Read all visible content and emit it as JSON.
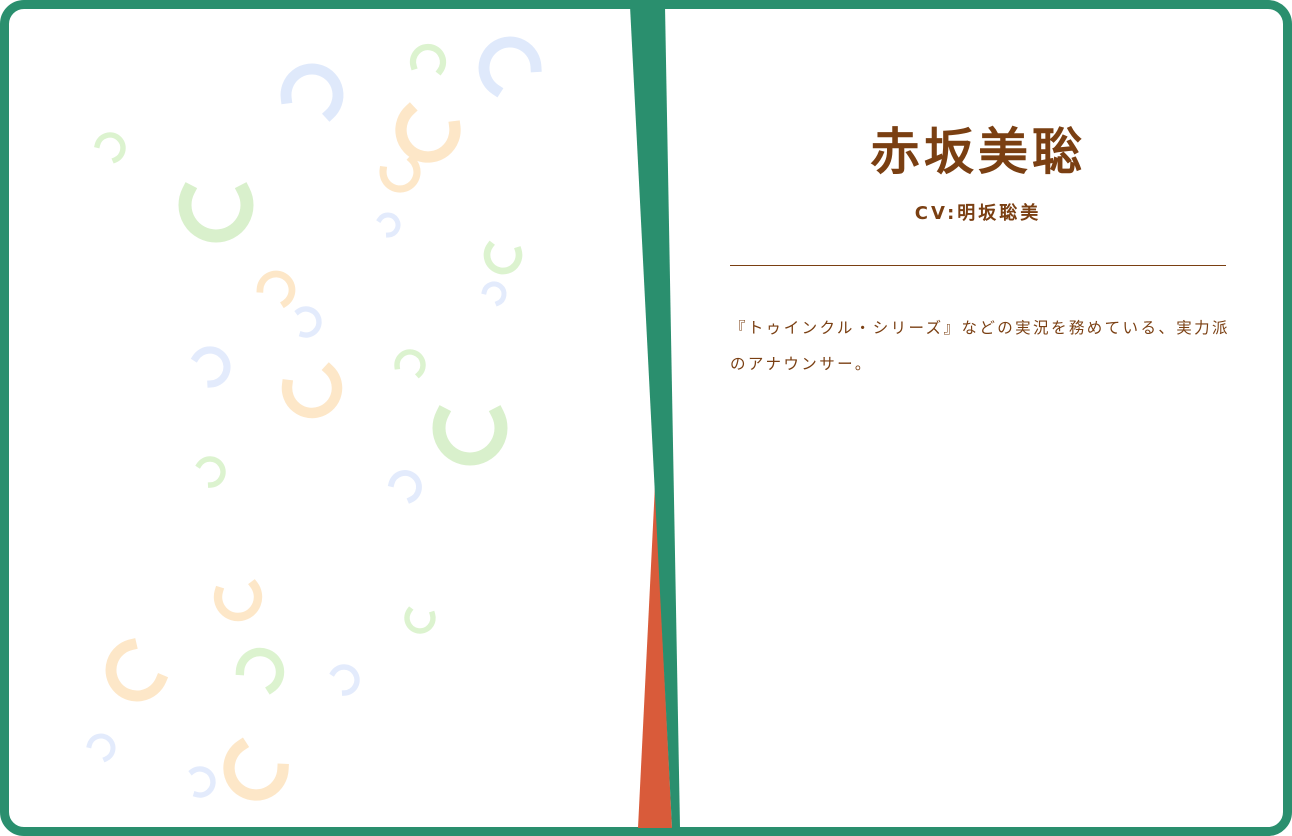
{
  "profile": {
    "name": "赤坂美聡",
    "cv": "CV:明坂聡美",
    "description": "『トゥインクル・シリーズ』などの実況を務めている、実力派のアナウンサー。"
  },
  "colors": {
    "border": "#2a8f6e",
    "accent_red": "#d95b3a",
    "text": "#7a3f12"
  }
}
